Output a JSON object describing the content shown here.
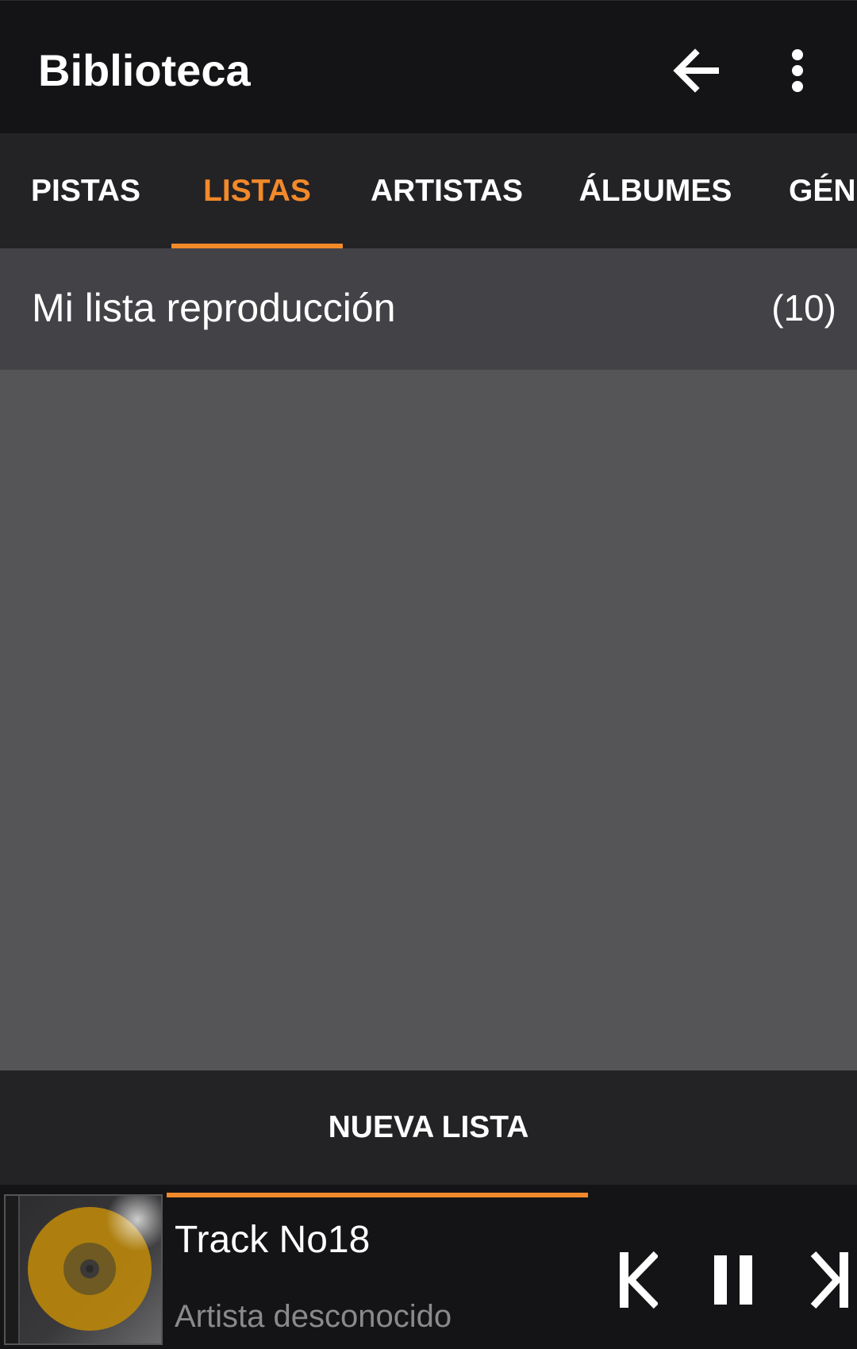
{
  "appbar": {
    "title": "Biblioteca",
    "back_icon": "arrow-left-icon",
    "more_icon": "more-vertical-icon"
  },
  "tabs": [
    {
      "label": "PISTAS",
      "active": false
    },
    {
      "label": "LISTAS",
      "active": true
    },
    {
      "label": "ARTISTAS",
      "active": false
    },
    {
      "label": "ÁLBUMES",
      "active": false
    },
    {
      "label": "GÉN",
      "active": false
    }
  ],
  "playlists": [
    {
      "name": "Mi lista reproducción",
      "count": "(10)"
    }
  ],
  "new_list_label": "NUEVA LISTA",
  "player": {
    "track_title": "Track No18",
    "artist": "Artista desconocido",
    "progress": 0.5,
    "controls": [
      "skip-previous-icon",
      "pause-icon",
      "skip-next-icon"
    ]
  },
  "colors": {
    "accent": "#f2892a",
    "appbar_bg": "#141315",
    "tabbar_bg": "#232225",
    "content_bg": "#555457",
    "row_bg": "#434246",
    "cover_disc": "#b8860b"
  }
}
